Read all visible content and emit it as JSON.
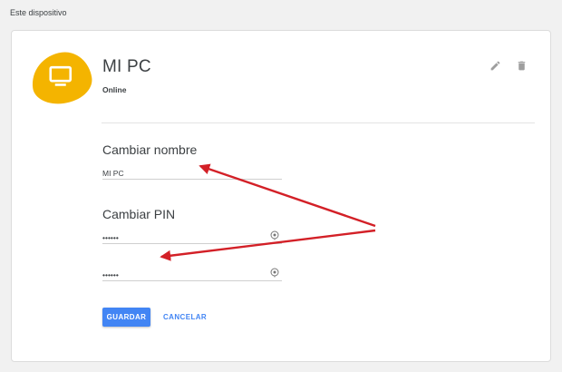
{
  "section": {
    "title": "Este dispositivo"
  },
  "device": {
    "name": "MI PC",
    "status": "Online",
    "icon": "monitor-icon",
    "icon_bg_color": "#f4b400"
  },
  "actions": {
    "edit_icon": "pencil-icon",
    "delete_icon": "trash-icon"
  },
  "rename": {
    "title": "Cambiar nombre",
    "value": "MI PC"
  },
  "pin": {
    "title": "Cambiar PIN",
    "value": "••••••",
    "confirm_value": "••••••",
    "toggle_icon": "eye-icon"
  },
  "buttons": {
    "save_label": "GUARDAR",
    "cancel_label": "CANCELAR"
  },
  "colors": {
    "accent": "#4285f4",
    "annotation_arrow": "#d32027"
  }
}
